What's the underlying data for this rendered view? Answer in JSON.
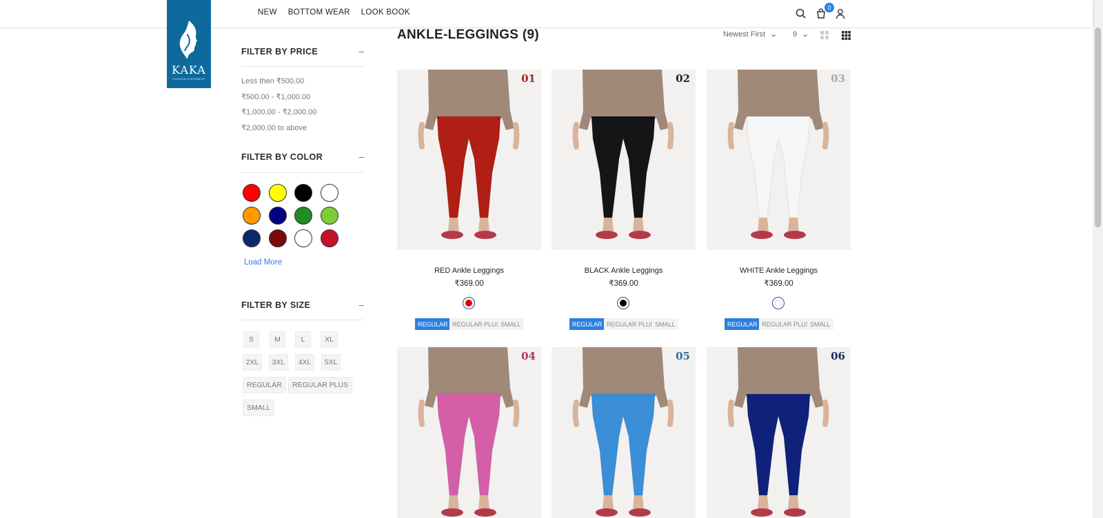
{
  "header": {
    "logo_text": "KAKA",
    "logo_sub": "FASHION STATEMENT",
    "nav": [
      "NEW",
      "BOTTOM WEAR",
      "LOOK BOOK"
    ],
    "cart_count": "0",
    "icons": [
      "search-icon",
      "cart-icon",
      "user-icon"
    ]
  },
  "sidebar": {
    "price": {
      "title": "FILTER BY PRICE",
      "toggle": "–",
      "options": [
        "Less then ₹500.00",
        "₹500.00 - ₹1,000.00",
        "₹1,000.00 - ₹2,000.00",
        "₹2,000.00 to above"
      ]
    },
    "color": {
      "title": "FILTER BY COLOR",
      "toggle": "–",
      "swatches": [
        "#ff0000",
        "#ffff00",
        "#000000",
        "#ffffff",
        "#ff9900",
        "#000080",
        "#228b22",
        "#7ccd3a",
        "#0b2a6b",
        "#7a0a0a",
        "#ffffff",
        "#c4122a"
      ],
      "load_more": "Load More"
    },
    "size": {
      "title": "FILTER BY SIZE",
      "toggle": "–",
      "options": [
        "S",
        "M",
        "L",
        "XL",
        "2XL",
        "3XL",
        "4XL",
        "5XL",
        "REGULAR",
        "REGULAR PLUS",
        "SMALL"
      ]
    }
  },
  "main": {
    "title": "ANKLE-LEGGINGS (9)",
    "sort": "Newest First",
    "per_page": "9",
    "view_icons": [
      "grid-2-icon",
      "grid-3-icon"
    ],
    "products": [
      {
        "num": "01",
        "num_color": "#9b2a2a",
        "name": "RED Ankle Leggings",
        "price": "₹369.00",
        "legging": "#b01e14",
        "swatch": "#e00000",
        "sizes": [
          "REGULAR",
          "REGULAR PLUS",
          "SMALL"
        ]
      },
      {
        "num": "02",
        "num_color": "#222222",
        "name": "BLACK Ankle Leggings",
        "price": "₹369.00",
        "legging": "#151515",
        "swatch": "#000000",
        "sizes": [
          "REGULAR",
          "REGULAR PLUS",
          "SMALL"
        ]
      },
      {
        "num": "03",
        "num_color": "#aaaaaa",
        "name": "WHITE Ankle Leggings",
        "price": "₹369.00",
        "legging": "#f6f6f6",
        "swatch": "#ffffff",
        "sizes": [
          "REGULAR",
          "REGULAR PLUS",
          "SMALL"
        ]
      },
      {
        "num": "04",
        "num_color": "#b0306b",
        "legging": "#d45fa8"
      },
      {
        "num": "05",
        "num_color": "#2a6c9c",
        "legging": "#3b8fd6"
      },
      {
        "num": "06",
        "num_color": "#1a2a5a",
        "legging": "#10217a"
      }
    ]
  }
}
